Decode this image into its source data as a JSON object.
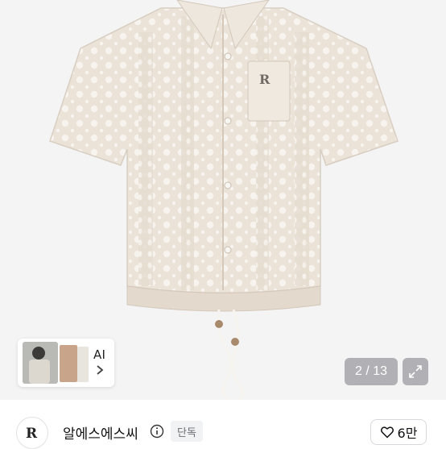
{
  "product": {
    "image_icon": "crochet-shirt-image",
    "page_current": "2",
    "page_total": "13",
    "page_indicator": "2 / 13"
  },
  "related": {
    "label": "AI",
    "chevron_icon": "chevron-right-icon"
  },
  "seller": {
    "name": "알에스에스씨",
    "badge": "단독",
    "info_icon": "info-icon",
    "like_count": "6만"
  },
  "colors": {
    "gallery_bg": "#f4f4f5",
    "shirt": "#ebe3d8",
    "overlay": "#78787c"
  }
}
